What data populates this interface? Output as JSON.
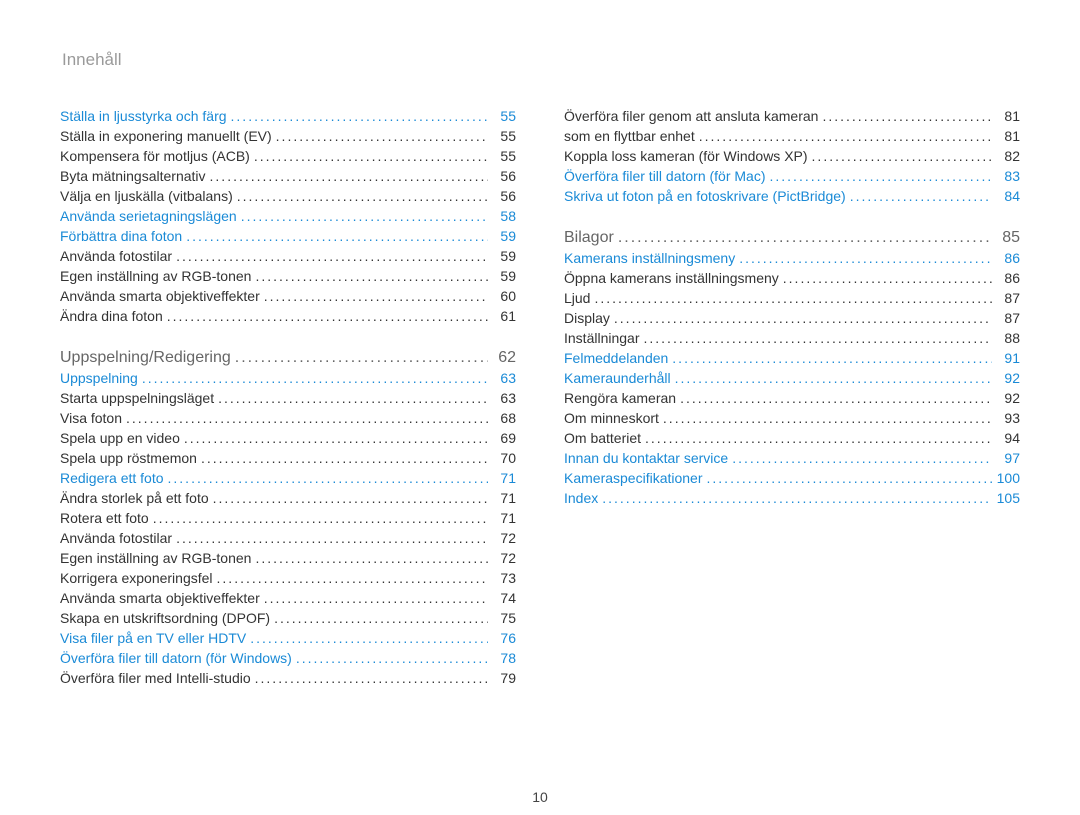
{
  "page_title": "Innehåll",
  "page_number": "10",
  "columns": [
    [
      {
        "level": 1,
        "label": "Ställa in ljusstyrka och färg",
        "page": "55"
      },
      {
        "level": 2,
        "label": "Ställa in exponering manuellt (EV)",
        "page": "55"
      },
      {
        "level": 2,
        "label": "Kompensera för motljus (ACB)",
        "page": "55"
      },
      {
        "level": 2,
        "label": "Byta mätningsalternativ",
        "page": "56"
      },
      {
        "level": 2,
        "label": "Välja en ljuskälla (vitbalans)",
        "page": "56"
      },
      {
        "level": 1,
        "label": "Använda serietagningslägen",
        "page": "58"
      },
      {
        "level": 1,
        "label": "Förbättra dina foton",
        "page": "59"
      },
      {
        "level": 2,
        "label": "Använda fotostilar",
        "page": "59"
      },
      {
        "level": 2,
        "label": "Egen inställning av RGB-tonen",
        "page": "59"
      },
      {
        "level": 2,
        "label": "Använda smarta objektiveffekter",
        "page": "60"
      },
      {
        "level": 2,
        "label": "Ändra dina foton",
        "page": "61"
      },
      {
        "level": 0,
        "label": "Uppspelning/Redigering",
        "page": "62"
      },
      {
        "level": 1,
        "label": "Uppspelning",
        "page": "63"
      },
      {
        "level": 2,
        "label": "Starta uppspelningsläget",
        "page": "63"
      },
      {
        "level": 2,
        "label": "Visa foton",
        "page": "68"
      },
      {
        "level": 2,
        "label": "Spela upp en video",
        "page": "69"
      },
      {
        "level": 2,
        "label": "Spela upp röstmemon",
        "page": "70"
      },
      {
        "level": 1,
        "label": "Redigera ett foto",
        "page": "71"
      },
      {
        "level": 2,
        "label": "Ändra storlek på ett foto",
        "page": "71"
      },
      {
        "level": 2,
        "label": "Rotera ett foto",
        "page": "71"
      },
      {
        "level": 2,
        "label": "Använda fotostilar",
        "page": "72"
      },
      {
        "level": 2,
        "label": "Egen inställning av RGB-tonen",
        "page": "72"
      },
      {
        "level": 2,
        "label": "Korrigera exponeringsfel",
        "page": "73"
      },
      {
        "level": 2,
        "label": "Använda smarta objektiveffekter",
        "page": "74"
      },
      {
        "level": 2,
        "label": "Skapa en utskriftsordning (DPOF)",
        "page": "75"
      },
      {
        "level": 1,
        "label": "Visa filer på en TV eller HDTV",
        "page": "76"
      },
      {
        "level": 1,
        "label": "Överföra filer till datorn (för Windows)",
        "page": "78"
      },
      {
        "level": 2,
        "label": "Överföra filer med Intelli-studio",
        "page": "79"
      }
    ],
    [
      {
        "level": 2,
        "label": "Överföra filer genom att ansluta kameran",
        "page": "81"
      },
      {
        "level": 2,
        "label": "som en flyttbar enhet",
        "page": "81"
      },
      {
        "level": 2,
        "label": "Koppla loss kameran (för Windows XP)",
        "page": "82"
      },
      {
        "level": 1,
        "label": "Överföra filer till datorn (för Mac)",
        "page": "83"
      },
      {
        "level": 1,
        "label": "Skriva ut foton på en fotoskrivare (PictBridge)",
        "page": "84"
      },
      {
        "level": 0,
        "label": "Bilagor",
        "page": "85"
      },
      {
        "level": 1,
        "label": "Kamerans inställningsmeny",
        "page": "86"
      },
      {
        "level": 2,
        "label": "Öppna kamerans inställningsmeny",
        "page": "86"
      },
      {
        "level": 2,
        "label": "Ljud",
        "page": "87"
      },
      {
        "level": 2,
        "label": "Display",
        "page": "87"
      },
      {
        "level": 2,
        "label": "Inställningar",
        "page": "88"
      },
      {
        "level": 1,
        "label": "Felmeddelanden",
        "page": "91"
      },
      {
        "level": 1,
        "label": "Kameraunderhåll",
        "page": "92"
      },
      {
        "level": 2,
        "label": "Rengöra kameran",
        "page": "92"
      },
      {
        "level": 2,
        "label": "Om minneskort",
        "page": "93"
      },
      {
        "level": 2,
        "label": "Om batteriet",
        "page": "94"
      },
      {
        "level": 1,
        "label": "Innan du kontaktar service",
        "page": "97"
      },
      {
        "level": 1,
        "label": "Kameraspecifikationer",
        "page": "100"
      },
      {
        "level": 1,
        "label": "Index",
        "page": "105"
      }
    ]
  ]
}
